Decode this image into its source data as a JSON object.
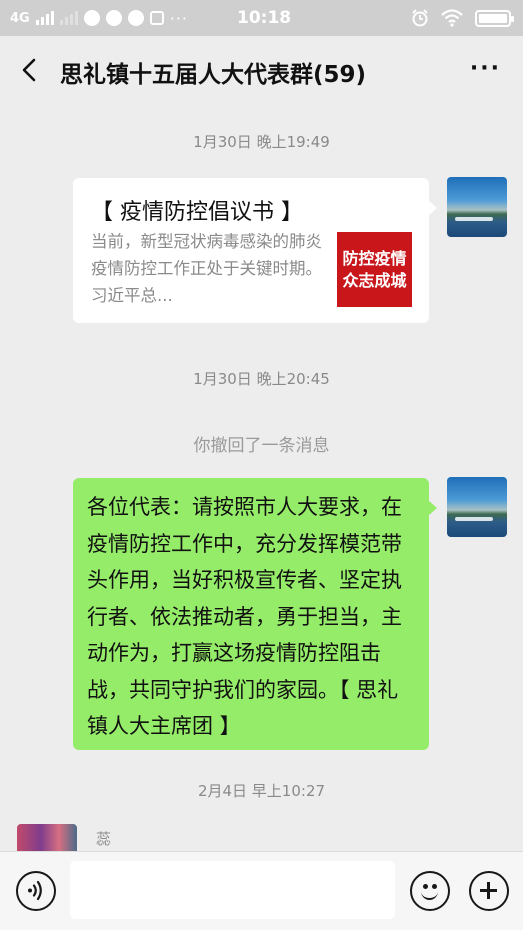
{
  "status_bar": {
    "network": "4G",
    "time": "10:18",
    "more": "···"
  },
  "header": {
    "title": "思礼镇十五届人大代表群(59)",
    "more": "···"
  },
  "messages": [
    {
      "type": "timestamp",
      "text": "1月30日 晚上19:49"
    },
    {
      "type": "article_card",
      "sender": "self",
      "title": "【 疫情防控倡议书 】",
      "description": "当前，新型冠状病毒感染的肺炎疫情防控工作正处于关键时期。习近平总...",
      "thumbnail_lines": [
        "防控疫情",
        "众志成城"
      ]
    },
    {
      "type": "timestamp",
      "text": "1月30日 晚上20:45"
    },
    {
      "type": "system",
      "text": "你撤回了一条消息"
    },
    {
      "type": "text",
      "sender": "self",
      "text": "各位代表：请按照市人大要求，在疫情防控工作中，充分发挥模范带头作用，当好积极宣传者、坚定执行者、依法推动者，勇于担当，主动作为，打赢这场疫情防控阻击战，共同守护我们的家园。【 思礼镇人大主席团 】"
    },
    {
      "type": "timestamp",
      "text": "2月4日 早上10:27"
    },
    {
      "type": "incoming_partial",
      "sender_name": "蕊"
    }
  ],
  "input_bar": {
    "voice_icon": "voice-icon",
    "emoji_icon": "emoji-icon",
    "plus_icon": "plus-icon"
  }
}
